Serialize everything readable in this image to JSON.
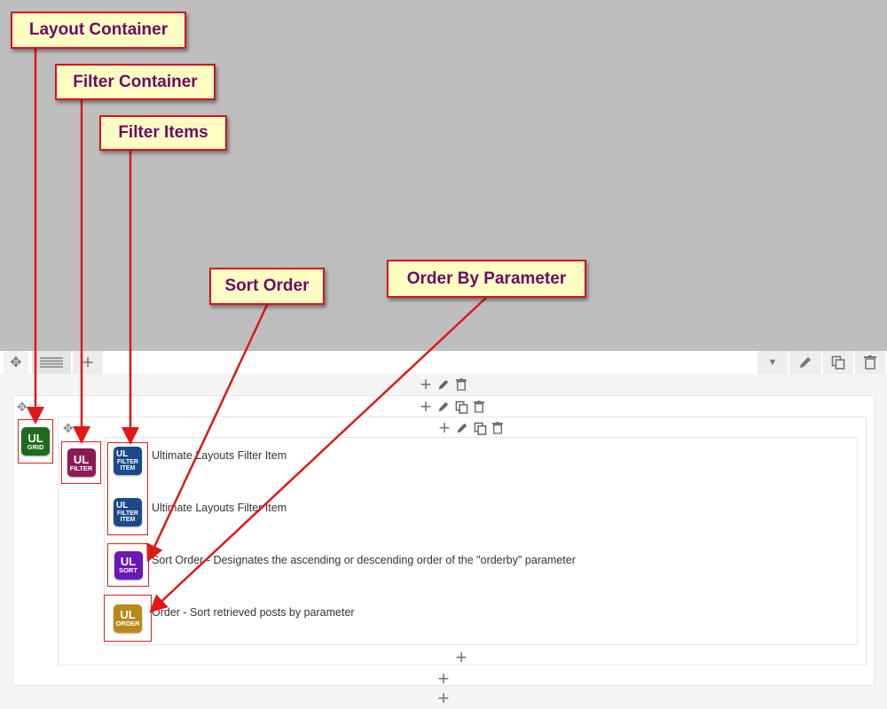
{
  "callouts": {
    "layout_container": "Layout Container",
    "filter_container": "Filter Container",
    "filter_items": "Filter Items",
    "sort_order": "Sort Order",
    "order_by_parameter": "Order By Parameter"
  },
  "modules": {
    "grid": {
      "badge": "UL",
      "sub": "GRID"
    },
    "filter": {
      "badge": "UL",
      "sub": "FILTER"
    },
    "filter_item_1": {
      "badge": "UL",
      "sub": "FILTER ITEM",
      "label": "Ultimate Layouts Filter Item"
    },
    "filter_item_2": {
      "badge": "UL",
      "sub": "FILTER ITEM",
      "label": "Ultimate Layouts Filter Item"
    },
    "sort": {
      "badge": "UL",
      "sub": "SORT",
      "label": "Sort Order - Designates the ascending or descending order of the \"orderby\" parameter"
    },
    "order": {
      "badge": "UL",
      "sub": "ORDER",
      "label": "Order - Sort retrieved posts by parameter"
    }
  },
  "icons": {
    "drag": "move-icon",
    "layout": "layout-lines-icon",
    "add": "plus-icon",
    "dropdown": "chevron-down-icon",
    "edit": "pencil-icon",
    "copy": "copy-icon",
    "delete": "trash-icon"
  },
  "colors": {
    "callout_bg": "#ffffc4",
    "callout_border": "#d4141e",
    "callout_text": "#6d0a63",
    "arrow": "#e01818",
    "grid_badge": "#1e6b1e",
    "filter_badge": "#8e1a55",
    "item_badge": "#1a4a8a",
    "sort_badge": "#6a18b8",
    "order_badge": "#b8891a"
  }
}
